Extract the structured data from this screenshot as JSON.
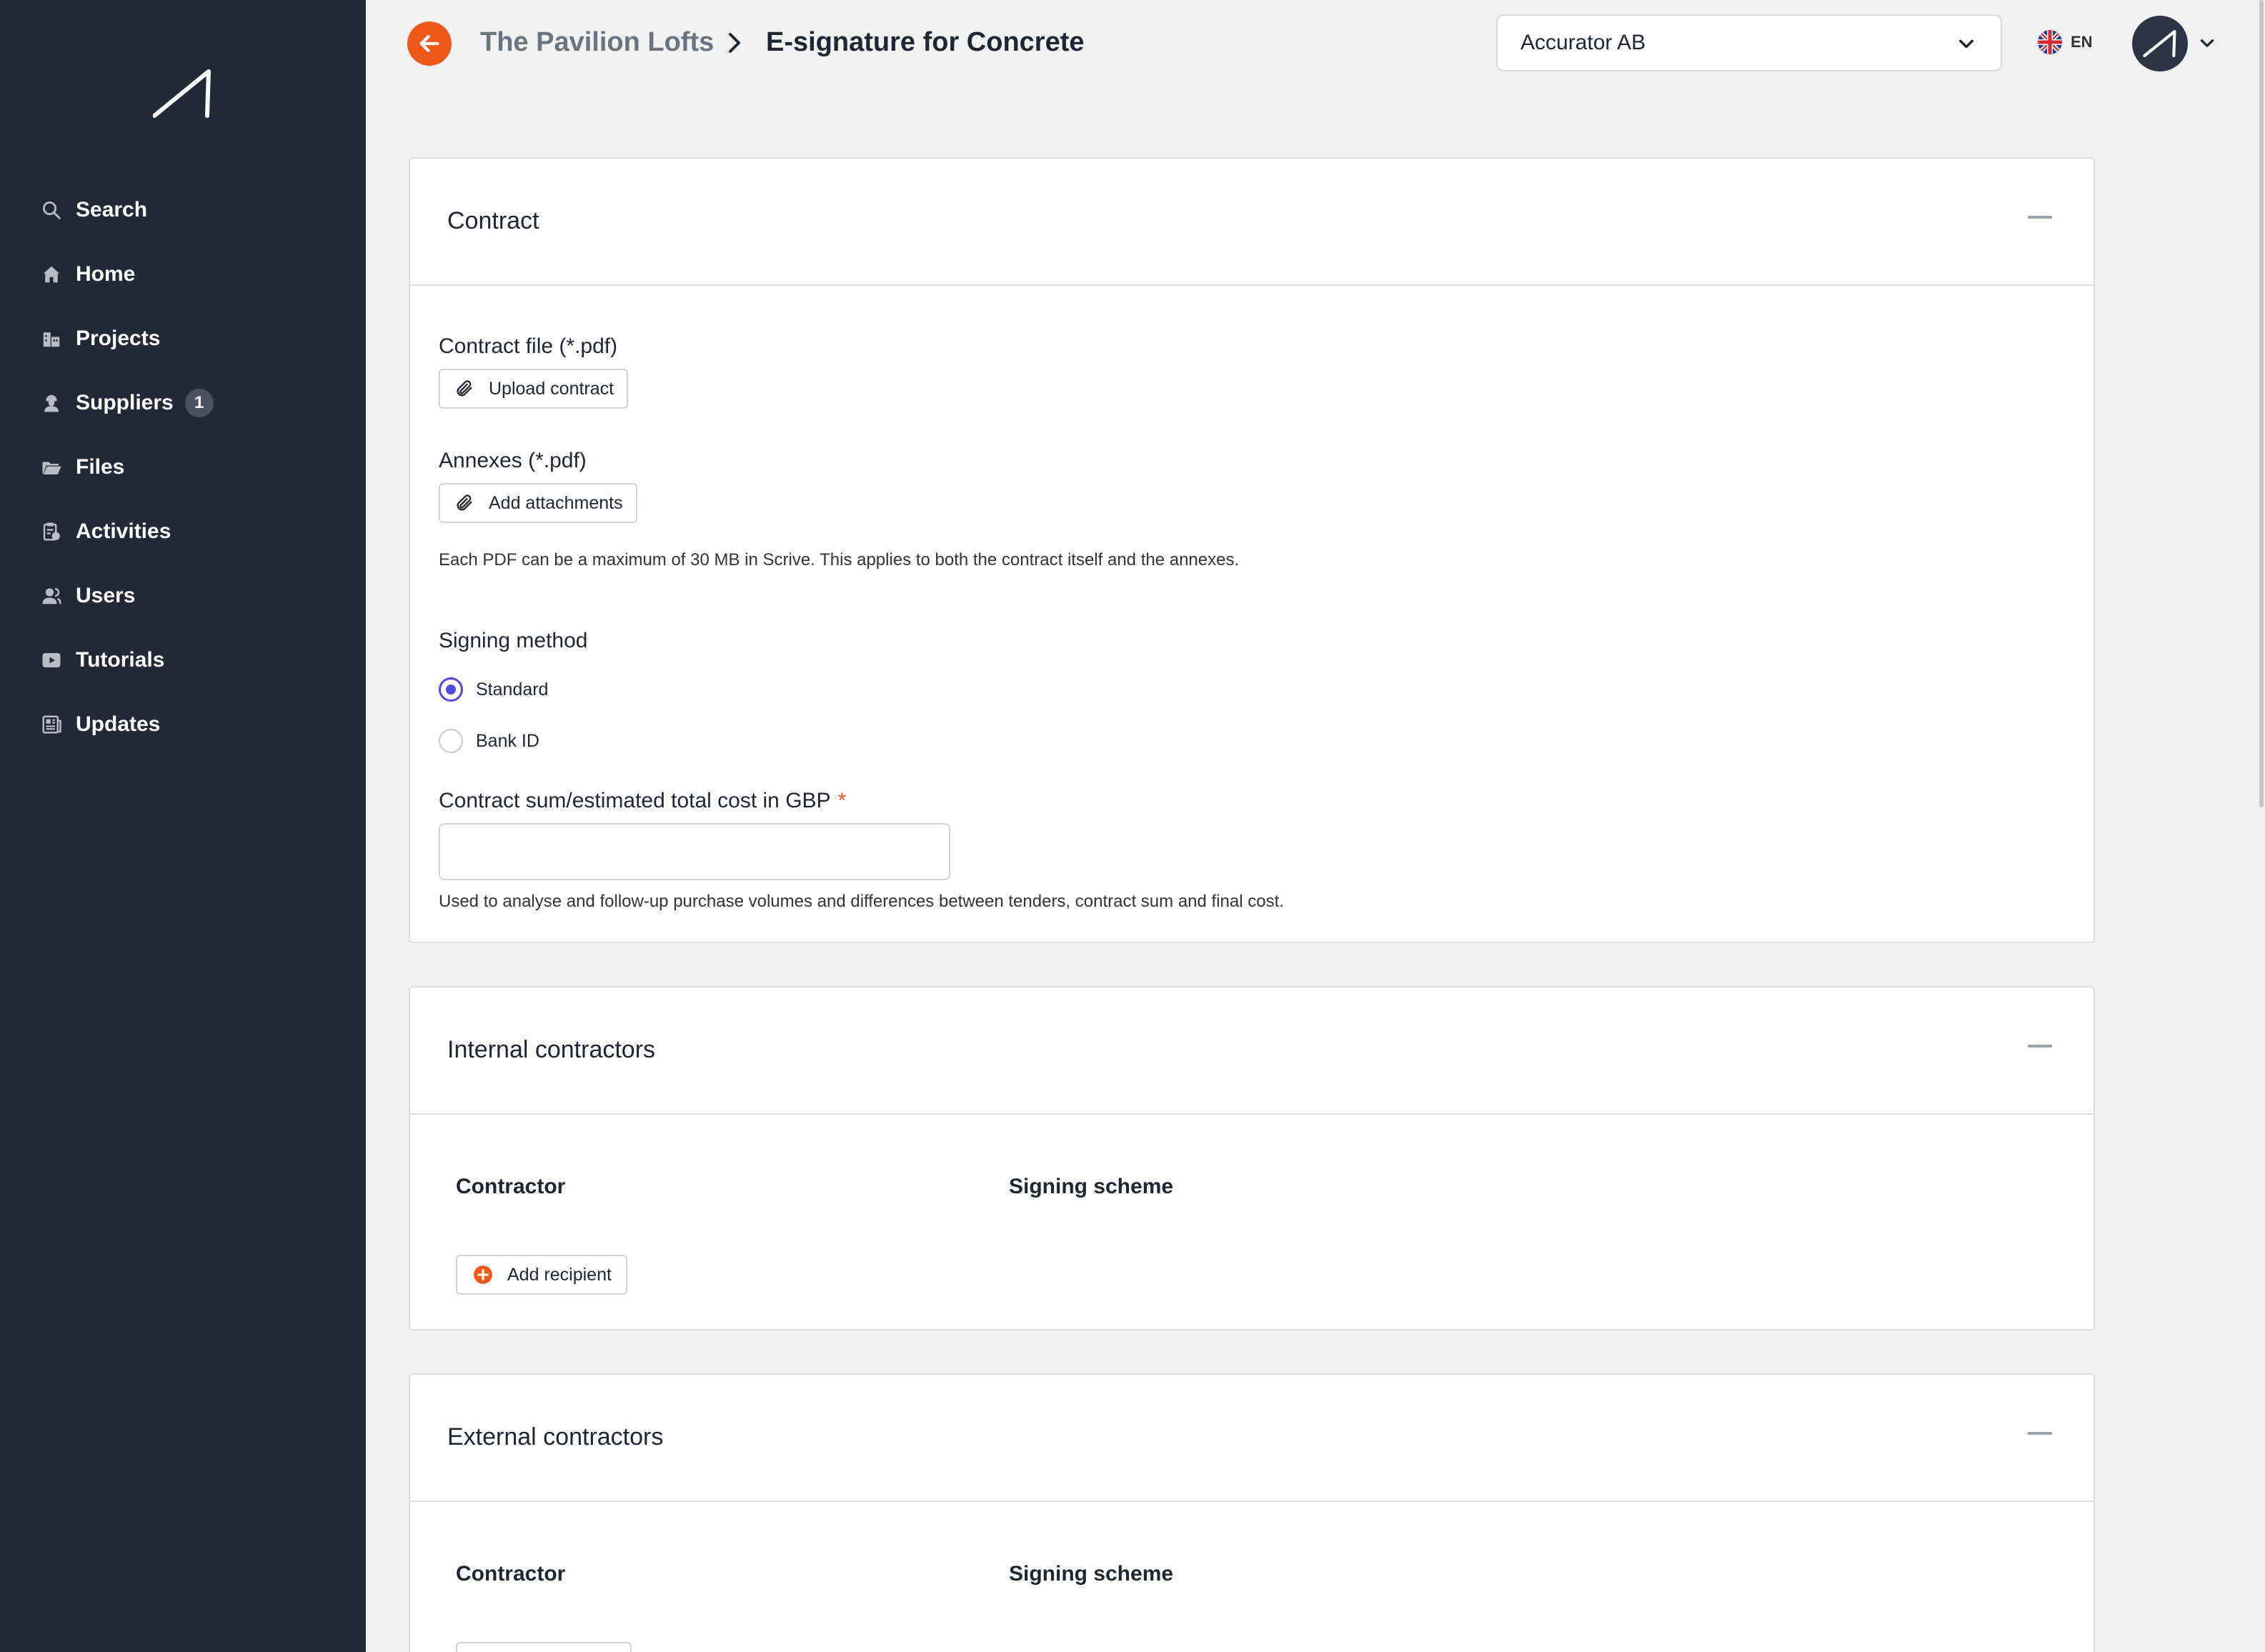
{
  "sidebar": {
    "items": [
      {
        "label": "Search",
        "icon": "search-icon"
      },
      {
        "label": "Home",
        "icon": "home-icon"
      },
      {
        "label": "Projects",
        "icon": "projects-icon"
      },
      {
        "label": "Suppliers",
        "icon": "suppliers-icon",
        "badge": "1"
      },
      {
        "label": "Files",
        "icon": "folder-icon"
      },
      {
        "label": "Activities",
        "icon": "activities-icon"
      },
      {
        "label": "Users",
        "icon": "users-icon"
      },
      {
        "label": "Tutorials",
        "icon": "video-icon"
      },
      {
        "label": "Updates",
        "icon": "news-icon"
      }
    ]
  },
  "header": {
    "breadcrumb_parent": "The Pavilion Lofts",
    "breadcrumb_current": "E-signature for Concrete",
    "company": "Accurator AB",
    "language": "EN"
  },
  "contract": {
    "title": "Contract",
    "file_label": "Contract file (*.pdf)",
    "upload_label": "Upload contract",
    "annex_label": "Annexes (*.pdf)",
    "attach_label": "Add attachments",
    "size_hint": "Each PDF can be a maximum of 30 MB in Scrive. This applies to both the contract itself and the annexes.",
    "signing_label": "Signing method",
    "signing_options": [
      {
        "label": "Standard",
        "selected": true
      },
      {
        "label": "Bank ID",
        "selected": false
      }
    ],
    "sum_label": "Contract sum/estimated total cost in GBP",
    "required_mark": "*",
    "sum_value": "",
    "sum_hint": "Used to analyse and follow-up purchase volumes and differences between tenders, contract sum and final cost."
  },
  "internal": {
    "title": "Internal contractors",
    "col_contractor": "Contractor",
    "col_scheme": "Signing scheme",
    "add_label": "Add recipient"
  },
  "external": {
    "title": "External contractors",
    "col_contractor": "Contractor",
    "col_scheme": "Signing scheme"
  },
  "colors": {
    "sidebar": "#212836",
    "accent": "#f2571a",
    "radio": "#5148e0"
  }
}
